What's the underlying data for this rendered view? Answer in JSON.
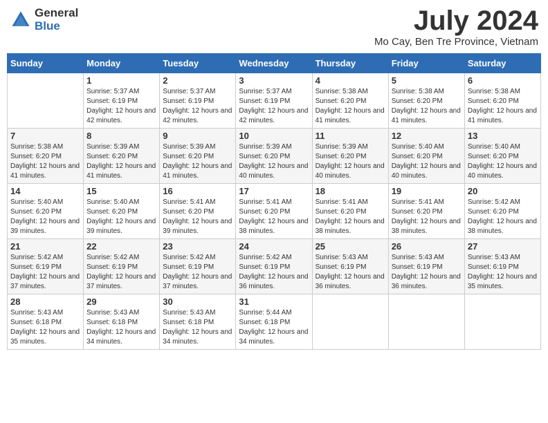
{
  "header": {
    "logo_general": "General",
    "logo_blue": "Blue",
    "month_year": "July 2024",
    "location": "Mo Cay, Ben Tre Province, Vietnam"
  },
  "days_of_week": [
    "Sunday",
    "Monday",
    "Tuesday",
    "Wednesday",
    "Thursday",
    "Friday",
    "Saturday"
  ],
  "weeks": [
    [
      {
        "day": "",
        "sunrise": "",
        "sunset": "",
        "daylight": ""
      },
      {
        "day": "1",
        "sunrise": "Sunrise: 5:37 AM",
        "sunset": "Sunset: 6:19 PM",
        "daylight": "Daylight: 12 hours and 42 minutes."
      },
      {
        "day": "2",
        "sunrise": "Sunrise: 5:37 AM",
        "sunset": "Sunset: 6:19 PM",
        "daylight": "Daylight: 12 hours and 42 minutes."
      },
      {
        "day": "3",
        "sunrise": "Sunrise: 5:37 AM",
        "sunset": "Sunset: 6:19 PM",
        "daylight": "Daylight: 12 hours and 42 minutes."
      },
      {
        "day": "4",
        "sunrise": "Sunrise: 5:38 AM",
        "sunset": "Sunset: 6:20 PM",
        "daylight": "Daylight: 12 hours and 41 minutes."
      },
      {
        "day": "5",
        "sunrise": "Sunrise: 5:38 AM",
        "sunset": "Sunset: 6:20 PM",
        "daylight": "Daylight: 12 hours and 41 minutes."
      },
      {
        "day": "6",
        "sunrise": "Sunrise: 5:38 AM",
        "sunset": "Sunset: 6:20 PM",
        "daylight": "Daylight: 12 hours and 41 minutes."
      }
    ],
    [
      {
        "day": "7",
        "sunrise": "Sunrise: 5:38 AM",
        "sunset": "Sunset: 6:20 PM",
        "daylight": "Daylight: 12 hours and 41 minutes."
      },
      {
        "day": "8",
        "sunrise": "Sunrise: 5:39 AM",
        "sunset": "Sunset: 6:20 PM",
        "daylight": "Daylight: 12 hours and 41 minutes."
      },
      {
        "day": "9",
        "sunrise": "Sunrise: 5:39 AM",
        "sunset": "Sunset: 6:20 PM",
        "daylight": "Daylight: 12 hours and 41 minutes."
      },
      {
        "day": "10",
        "sunrise": "Sunrise: 5:39 AM",
        "sunset": "Sunset: 6:20 PM",
        "daylight": "Daylight: 12 hours and 40 minutes."
      },
      {
        "day": "11",
        "sunrise": "Sunrise: 5:39 AM",
        "sunset": "Sunset: 6:20 PM",
        "daylight": "Daylight: 12 hours and 40 minutes."
      },
      {
        "day": "12",
        "sunrise": "Sunrise: 5:40 AM",
        "sunset": "Sunset: 6:20 PM",
        "daylight": "Daylight: 12 hours and 40 minutes."
      },
      {
        "day": "13",
        "sunrise": "Sunrise: 5:40 AM",
        "sunset": "Sunset: 6:20 PM",
        "daylight": "Daylight: 12 hours and 40 minutes."
      }
    ],
    [
      {
        "day": "14",
        "sunrise": "Sunrise: 5:40 AM",
        "sunset": "Sunset: 6:20 PM",
        "daylight": "Daylight: 12 hours and 39 minutes."
      },
      {
        "day": "15",
        "sunrise": "Sunrise: 5:40 AM",
        "sunset": "Sunset: 6:20 PM",
        "daylight": "Daylight: 12 hours and 39 minutes."
      },
      {
        "day": "16",
        "sunrise": "Sunrise: 5:41 AM",
        "sunset": "Sunset: 6:20 PM",
        "daylight": "Daylight: 12 hours and 39 minutes."
      },
      {
        "day": "17",
        "sunrise": "Sunrise: 5:41 AM",
        "sunset": "Sunset: 6:20 PM",
        "daylight": "Daylight: 12 hours and 38 minutes."
      },
      {
        "day": "18",
        "sunrise": "Sunrise: 5:41 AM",
        "sunset": "Sunset: 6:20 PM",
        "daylight": "Daylight: 12 hours and 38 minutes."
      },
      {
        "day": "19",
        "sunrise": "Sunrise: 5:41 AM",
        "sunset": "Sunset: 6:20 PM",
        "daylight": "Daylight: 12 hours and 38 minutes."
      },
      {
        "day": "20",
        "sunrise": "Sunrise: 5:42 AM",
        "sunset": "Sunset: 6:20 PM",
        "daylight": "Daylight: 12 hours and 38 minutes."
      }
    ],
    [
      {
        "day": "21",
        "sunrise": "Sunrise: 5:42 AM",
        "sunset": "Sunset: 6:19 PM",
        "daylight": "Daylight: 12 hours and 37 minutes."
      },
      {
        "day": "22",
        "sunrise": "Sunrise: 5:42 AM",
        "sunset": "Sunset: 6:19 PM",
        "daylight": "Daylight: 12 hours and 37 minutes."
      },
      {
        "day": "23",
        "sunrise": "Sunrise: 5:42 AM",
        "sunset": "Sunset: 6:19 PM",
        "daylight": "Daylight: 12 hours and 37 minutes."
      },
      {
        "day": "24",
        "sunrise": "Sunrise: 5:42 AM",
        "sunset": "Sunset: 6:19 PM",
        "daylight": "Daylight: 12 hours and 36 minutes."
      },
      {
        "day": "25",
        "sunrise": "Sunrise: 5:43 AM",
        "sunset": "Sunset: 6:19 PM",
        "daylight": "Daylight: 12 hours and 36 minutes."
      },
      {
        "day": "26",
        "sunrise": "Sunrise: 5:43 AM",
        "sunset": "Sunset: 6:19 PM",
        "daylight": "Daylight: 12 hours and 36 minutes."
      },
      {
        "day": "27",
        "sunrise": "Sunrise: 5:43 AM",
        "sunset": "Sunset: 6:19 PM",
        "daylight": "Daylight: 12 hours and 35 minutes."
      }
    ],
    [
      {
        "day": "28",
        "sunrise": "Sunrise: 5:43 AM",
        "sunset": "Sunset: 6:18 PM",
        "daylight": "Daylight: 12 hours and 35 minutes."
      },
      {
        "day": "29",
        "sunrise": "Sunrise: 5:43 AM",
        "sunset": "Sunset: 6:18 PM",
        "daylight": "Daylight: 12 hours and 34 minutes."
      },
      {
        "day": "30",
        "sunrise": "Sunrise: 5:43 AM",
        "sunset": "Sunset: 6:18 PM",
        "daylight": "Daylight: 12 hours and 34 minutes."
      },
      {
        "day": "31",
        "sunrise": "Sunrise: 5:44 AM",
        "sunset": "Sunset: 6:18 PM",
        "daylight": "Daylight: 12 hours and 34 minutes."
      },
      {
        "day": "",
        "sunrise": "",
        "sunset": "",
        "daylight": ""
      },
      {
        "day": "",
        "sunrise": "",
        "sunset": "",
        "daylight": ""
      },
      {
        "day": "",
        "sunrise": "",
        "sunset": "",
        "daylight": ""
      }
    ]
  ]
}
